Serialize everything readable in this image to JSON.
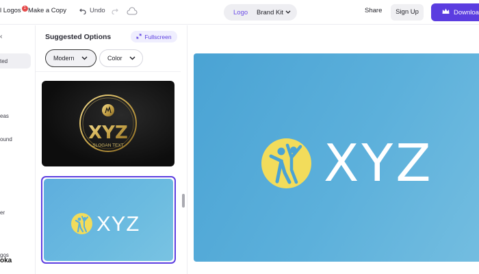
{
  "topbar": {
    "my_logos": "l Logos",
    "badge": "1",
    "make_copy": "Make a Copy",
    "undo": "Undo",
    "center_logo": "Logo",
    "center_brand_kit": "Brand Kit",
    "share": "Share",
    "sign_up": "Sign Up",
    "download": "Download"
  },
  "leftnav": {
    "items": [
      "ted",
      "eas",
      "ound",
      "er",
      "gos"
    ],
    "brand": "oka"
  },
  "panel": {
    "title": "Suggested Options",
    "fullscreen": "Fullscreen",
    "filters": [
      "Modern",
      "Color"
    ]
  },
  "logo": {
    "text": "XYZ",
    "slogan": "SLOGAN TEXT"
  },
  "colors": {
    "accent": "#5b3de0",
    "logo_bg": "#5cb0db",
    "logo_circle": "#f2dc5b",
    "gold": "#c9a64a"
  }
}
